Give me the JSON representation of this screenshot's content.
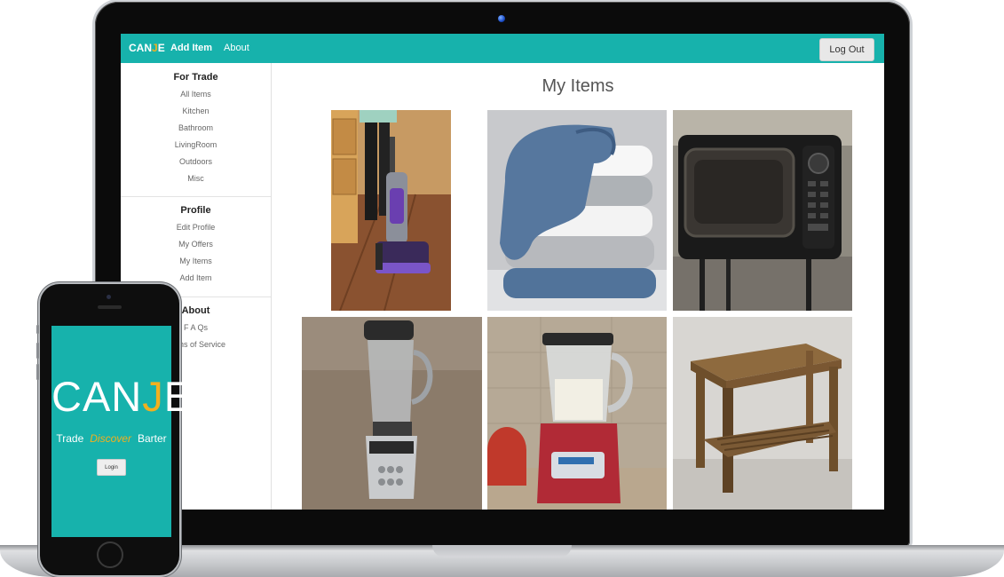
{
  "nav": {
    "brand_pre": "CAN",
    "brand_j": "J",
    "brand_post": "E",
    "add_item": "Add Item",
    "about": "About",
    "logout": "Log Out"
  },
  "sidebar": {
    "for_trade": {
      "heading": "For Trade",
      "items": [
        "All Items",
        "Kitchen",
        "Bathroom",
        "LivingRoom",
        "Outdoors",
        "Misc"
      ]
    },
    "profile": {
      "heading": "Profile",
      "items": [
        "Edit Profile",
        "My Offers",
        "My Items",
        "Add Item"
      ]
    },
    "about": {
      "heading": "About",
      "items": [
        "F A Qs",
        "Terms of Service"
      ]
    }
  },
  "main": {
    "title": "My Items",
    "items": [
      {
        "name": "vacuum-cleaner"
      },
      {
        "name": "towel-stack"
      },
      {
        "name": "microwave"
      },
      {
        "name": "blender-silver"
      },
      {
        "name": "blender-red"
      },
      {
        "name": "wooden-side-table"
      }
    ]
  },
  "phone": {
    "logo_pre": "CAN",
    "logo_j": "J",
    "logo_post": "E",
    "tag_left": "Trade",
    "tag_mid": "Discover",
    "tag_right": "Barter",
    "login": "Login"
  },
  "colors": {
    "accent": "#17b2ac",
    "brand_j": "#f2b01e"
  }
}
